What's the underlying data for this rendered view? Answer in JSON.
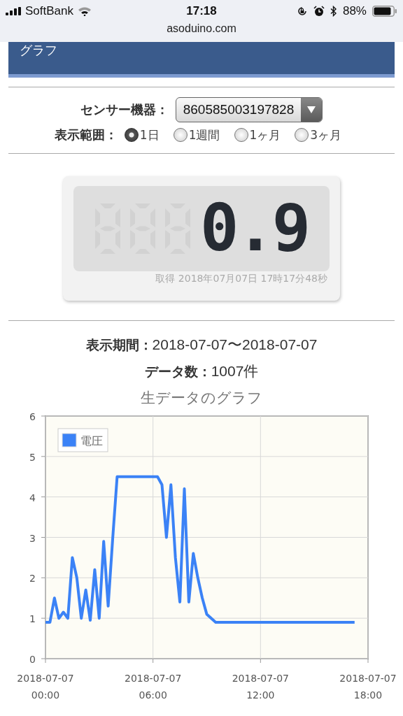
{
  "status_bar": {
    "carrier": "SoftBank",
    "time": "17:18",
    "battery": "88%",
    "url": "asoduino.com"
  },
  "header": {
    "title": "グラフ"
  },
  "form": {
    "device_label": "センサー機器：",
    "device_value": "860585003197828",
    "range_label": "表示範囲：",
    "ranges": [
      {
        "label": "1日",
        "selected": true
      },
      {
        "label": "1週間",
        "selected": false
      },
      {
        "label": "1ヶ月",
        "selected": false
      },
      {
        "label": "3ヶ月",
        "selected": false
      }
    ]
  },
  "meter": {
    "reading": "0.9",
    "timestamp": "取得 2018年07月07日 17時17分48秒"
  },
  "info": [
    {
      "label": "表示期間：",
      "value": "2018-07-07〜2018-07-07"
    },
    {
      "label": "データ数：",
      "value": "1007件"
    }
  ],
  "chart_title": "生データのグラフ",
  "chart_data": {
    "type": "line",
    "categories": [
      "2018-07-07\n00:00",
      null,
      null,
      null,
      null,
      null,
      null,
      null,
      null,
      null,
      null,
      null,
      null,
      null,
      null,
      null,
      null,
      null,
      null,
      null,
      null,
      null,
      null,
      null,
      "2018-07-07\n06:00",
      null,
      null,
      null,
      null,
      null,
      null,
      null,
      null,
      null,
      null,
      null,
      null,
      null,
      null,
      null,
      null,
      null,
      null,
      null,
      null,
      null,
      null,
      null,
      "2018-07-07\n12:00",
      null,
      null,
      null,
      null,
      null,
      null,
      null,
      null,
      null,
      null,
      null,
      null,
      null,
      null,
      null,
      null,
      null,
      null,
      null,
      null,
      null,
      null,
      null,
      "2018-07-07\n18:00"
    ],
    "series": [
      {
        "name": "電圧",
        "color": "#3b82f6",
        "values": [
          0.9,
          0.9,
          1.5,
          1.0,
          1.15,
          1.0,
          2.5,
          2.0,
          1.0,
          1.7,
          0.95,
          2.2,
          1.0,
          2.9,
          1.3,
          2.95,
          4.5,
          4.5,
          4.5,
          4.5,
          4.5,
          4.5,
          4.5,
          4.5,
          4.5,
          4.5,
          4.3,
          3.0,
          4.3,
          2.5,
          1.4,
          4.2,
          1.4,
          2.6,
          2.0,
          1.5,
          1.1,
          1.0,
          0.9,
          0.9,
          0.9,
          0.9,
          0.9,
          0.9,
          0.9,
          0.9,
          0.9,
          0.9,
          0.9,
          0.9,
          0.9,
          0.9,
          0.9,
          0.9,
          0.9,
          0.9,
          0.9,
          0.9,
          0.9,
          0.9,
          0.9,
          0.9,
          0.9,
          0.9,
          0.9,
          0.9,
          0.9,
          0.9,
          0.9,
          0.9,
          null,
          null,
          null
        ]
      }
    ],
    "grid": true,
    "ylim": [
      0,
      6
    ],
    "yticks": [
      0,
      1,
      2,
      3,
      4,
      5,
      6
    ]
  }
}
